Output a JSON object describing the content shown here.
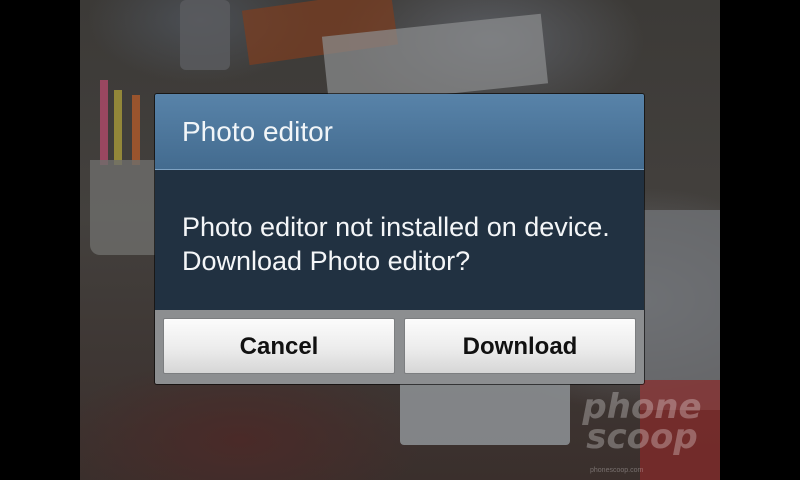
{
  "dialog": {
    "title": "Photo editor",
    "message": "Photo editor not installed on device. Download Photo editor?",
    "cancel_label": "Cancel",
    "download_label": "Download"
  },
  "watermark": {
    "text_line1": "phone",
    "text_line2": "scoop",
    "small_text": "phonescoop.com"
  }
}
